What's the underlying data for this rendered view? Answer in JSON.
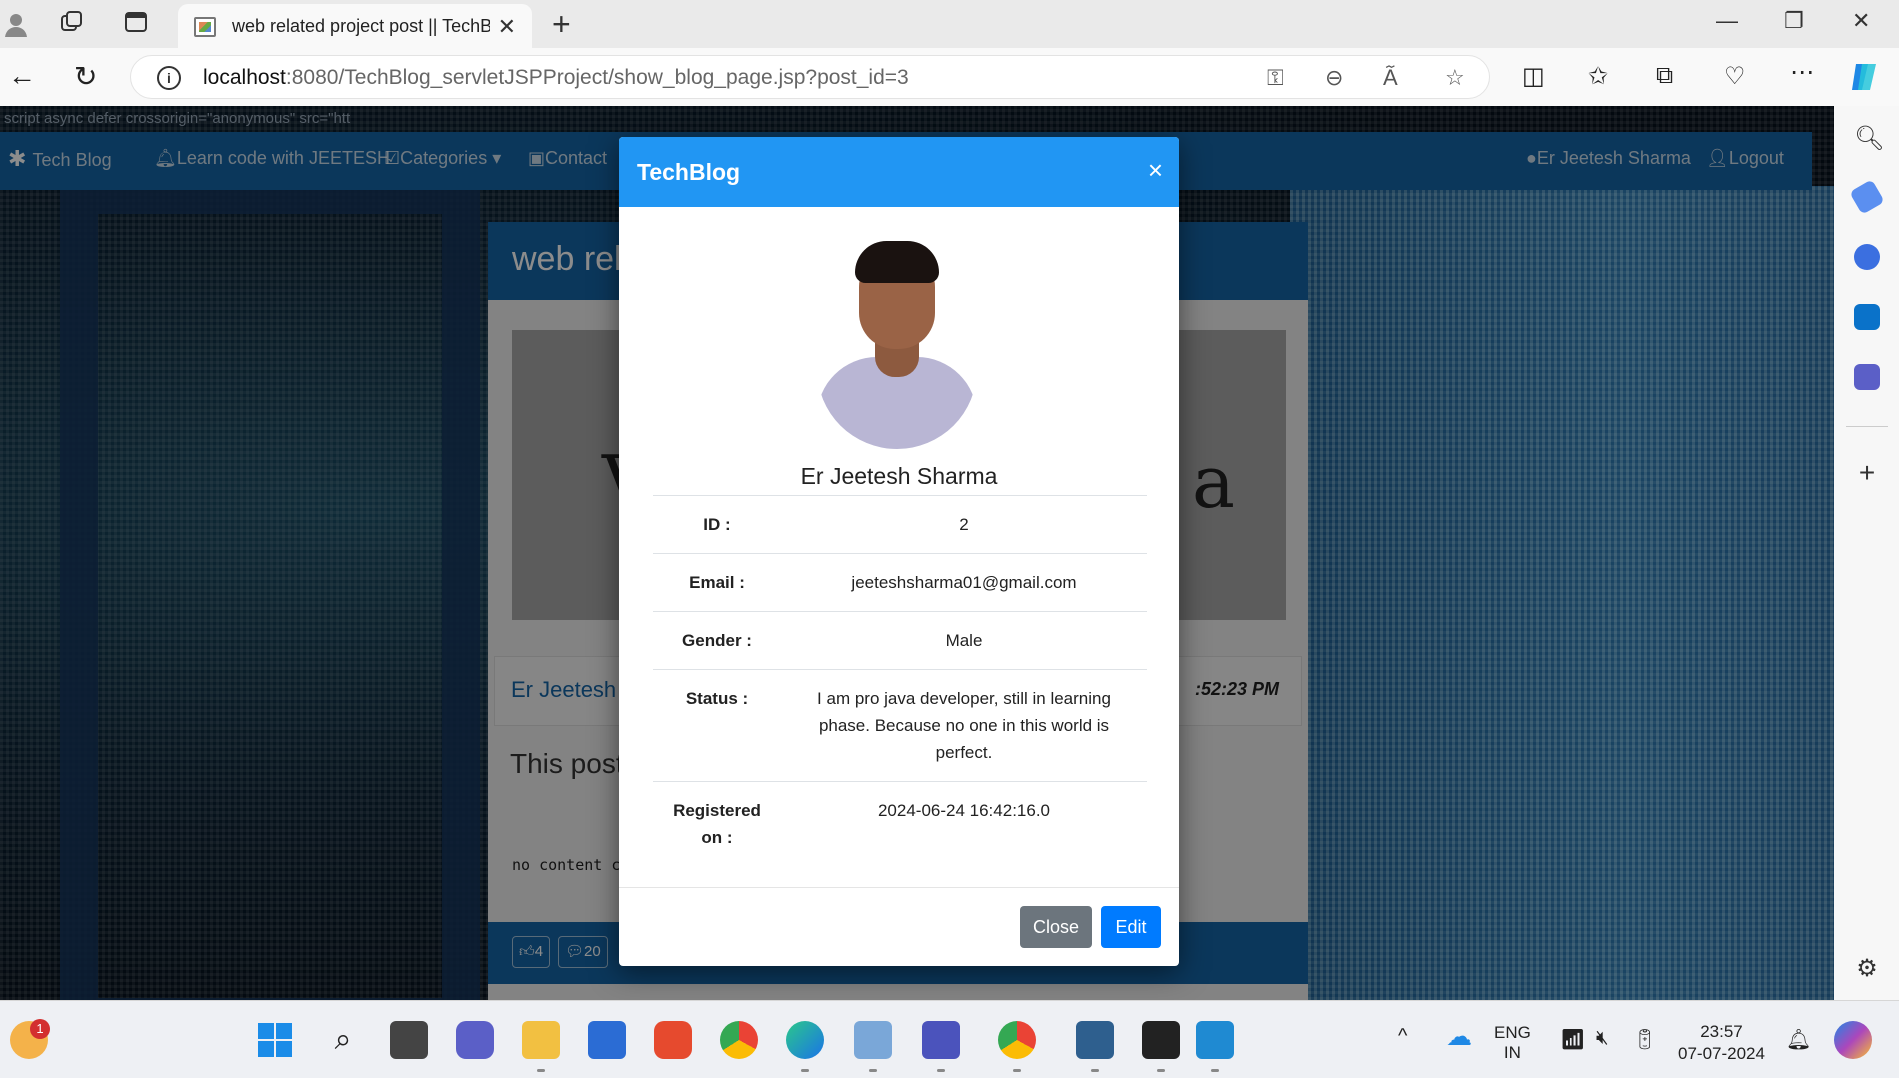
{
  "browser": {
    "tab_title": "web related project post || TechB",
    "url_host": "localhost",
    "url_path": ":8080/TechBlog_servletJSPProject/show_blog_page.jsp?post_id=3"
  },
  "page": {
    "script_text": "script async defer crossorigin=\"anonymous\" src=\"htt",
    "nav": {
      "brand": "Tech Blog",
      "learn": "Learn code with JEETESH",
      "categories": "Categories",
      "contact": "Contact",
      "user": "Er Jeetesh Sharma",
      "logout": "Logout"
    },
    "post": {
      "title_partial": "web rel",
      "author_partial": "Er Jeetesh",
      "time_partial": ":52:23 PM",
      "desc_partial": "This post",
      "content_partial": "no content co",
      "likes": "4",
      "comments": "20",
      "image_left_text": "V",
      "image_right_text": "a"
    }
  },
  "modal": {
    "title": "TechBlog",
    "close_x": "×",
    "name": "Er Jeetesh Sharma",
    "rows": [
      {
        "label": "ID :",
        "value": "2"
      },
      {
        "label": "Email :",
        "value": "jeeteshsharma01@gmail.com"
      },
      {
        "label": "Gender :",
        "value": "Male"
      },
      {
        "label": "Status :",
        "value": "I am pro java developer, still in learning phase. Because no one in this world is perfect."
      },
      {
        "label": "Registered on :",
        "value": "2024-06-24 16:42:16.0"
      }
    ],
    "close_button": "Close",
    "edit_button": "Edit"
  },
  "taskbar": {
    "lang_top": "ENG",
    "lang_bottom": "IN",
    "time": "23:57",
    "date": "07-07-2024",
    "notification_count": "1"
  },
  "colors": {
    "modal_header": "#2196f3",
    "site_nav": "#1565a6",
    "close_btn": "#6c757d",
    "edit_btn": "#007bff"
  }
}
